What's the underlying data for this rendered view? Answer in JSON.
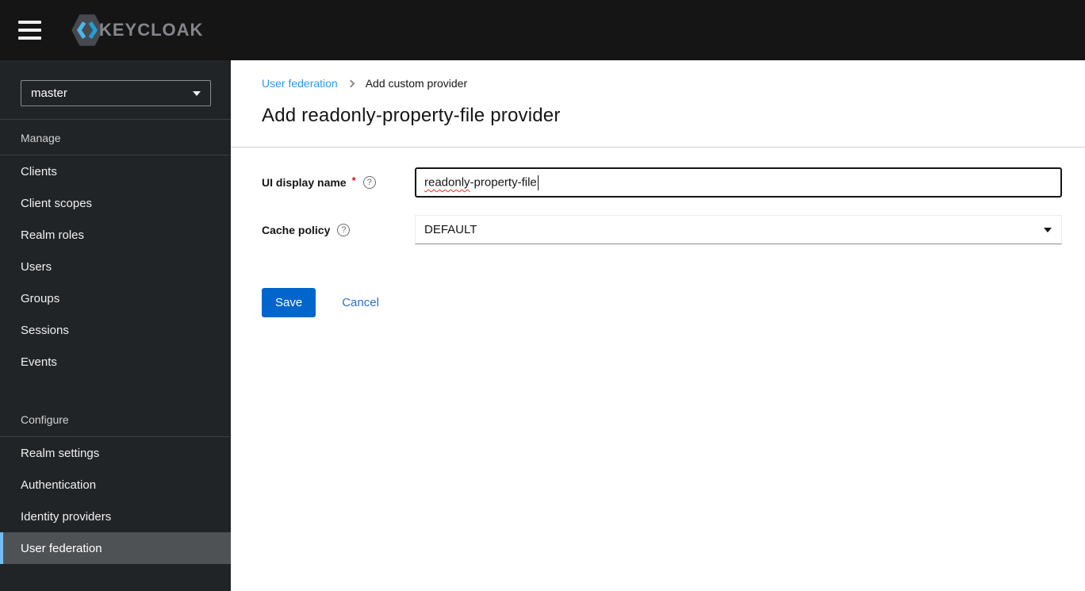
{
  "topbar": {
    "logo_text": "KEYCLOAK"
  },
  "sidebar": {
    "realm_selector": {
      "value": "master"
    },
    "sections": [
      {
        "title": "Manage",
        "items": [
          {
            "label": "Clients"
          },
          {
            "label": "Client scopes"
          },
          {
            "label": "Realm roles"
          },
          {
            "label": "Users"
          },
          {
            "label": "Groups"
          },
          {
            "label": "Sessions"
          },
          {
            "label": "Events"
          }
        ]
      },
      {
        "title": "Configure",
        "items": [
          {
            "label": "Realm settings"
          },
          {
            "label": "Authentication"
          },
          {
            "label": "Identity providers"
          },
          {
            "label": "User federation",
            "selected": true
          }
        ]
      }
    ]
  },
  "breadcrumb": {
    "items": [
      {
        "label": "User federation",
        "link": true
      },
      {
        "label": "Add custom provider",
        "link": false
      }
    ]
  },
  "page": {
    "title": "Add readonly-property-file provider"
  },
  "form": {
    "fields": [
      {
        "label": "UI display name",
        "required_marker": "*",
        "type": "text",
        "value": "readonly-property-file",
        "value_misspelled_part": "readonly",
        "value_rest": "-property-file",
        "focused": true
      },
      {
        "label": "Cache policy",
        "type": "select",
        "value": "DEFAULT"
      }
    ],
    "save_label": "Save",
    "cancel_label": "Cancel"
  },
  "icons": {
    "help_glyph": "?"
  },
  "colors": {
    "topbar_bg": "#151515",
    "sidebar_bg": "#212427",
    "sidebar_divider": "#3c3f42",
    "nav_selected_bg": "#4f5255",
    "nav_selected_border": "#73bcf7",
    "primary_button": "#0066cc",
    "breadcrumb_link": "#2b9af3",
    "cancel_link": "#2d71c8",
    "required_asterisk": "#c9190b",
    "spellcheck_underline": "#f4301b",
    "input_focus_border": "#151515",
    "logo_blue_light": "#4ab8e8",
    "logo_blue_dark": "#1e9fd6",
    "logo_hexagon": "#47494e",
    "logo_text": "#84868b"
  }
}
